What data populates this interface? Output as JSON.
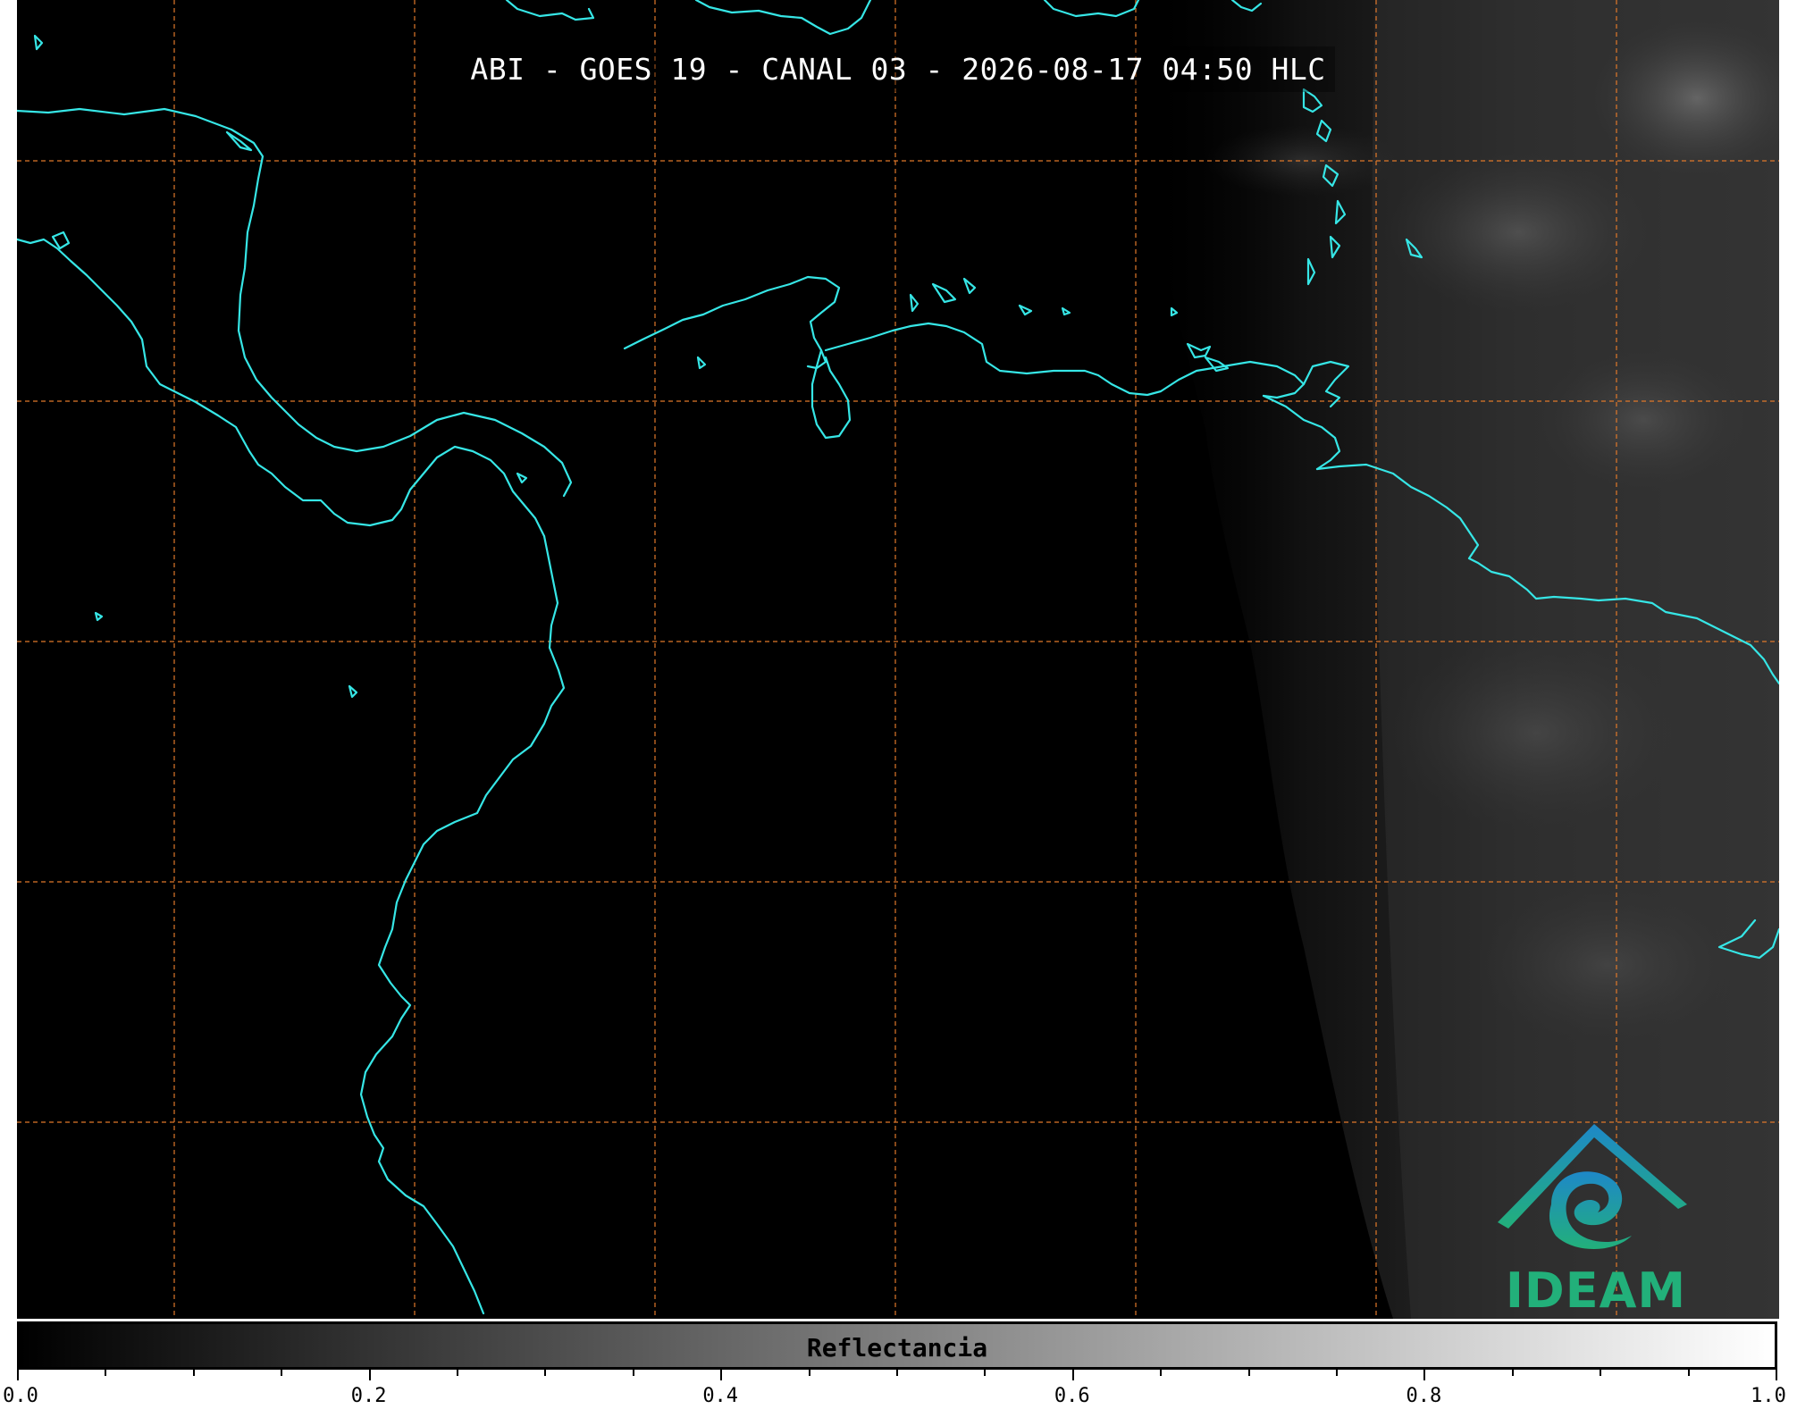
{
  "title": "ABI - GOES 19 - CANAL 03 - 2026-08-17 04:50 HLC",
  "colorbar": {
    "label": "Reflectancia",
    "min": 0.0,
    "max": 1.0,
    "ticks": [
      "0.0",
      "0.2",
      "0.4",
      "0.6",
      "0.8",
      "1.0"
    ],
    "minor_step": 0.05,
    "gradient_from": "#000000",
    "gradient_to": "#ffffff"
  },
  "logo": {
    "text": "IDEAM",
    "color_top": "#1e88c8",
    "color_bottom": "#22b07a"
  },
  "map": {
    "grid_line_color": "#e0782a",
    "coastline_color": "#36e6e6",
    "background": "#000000",
    "cloud_region": "east"
  }
}
